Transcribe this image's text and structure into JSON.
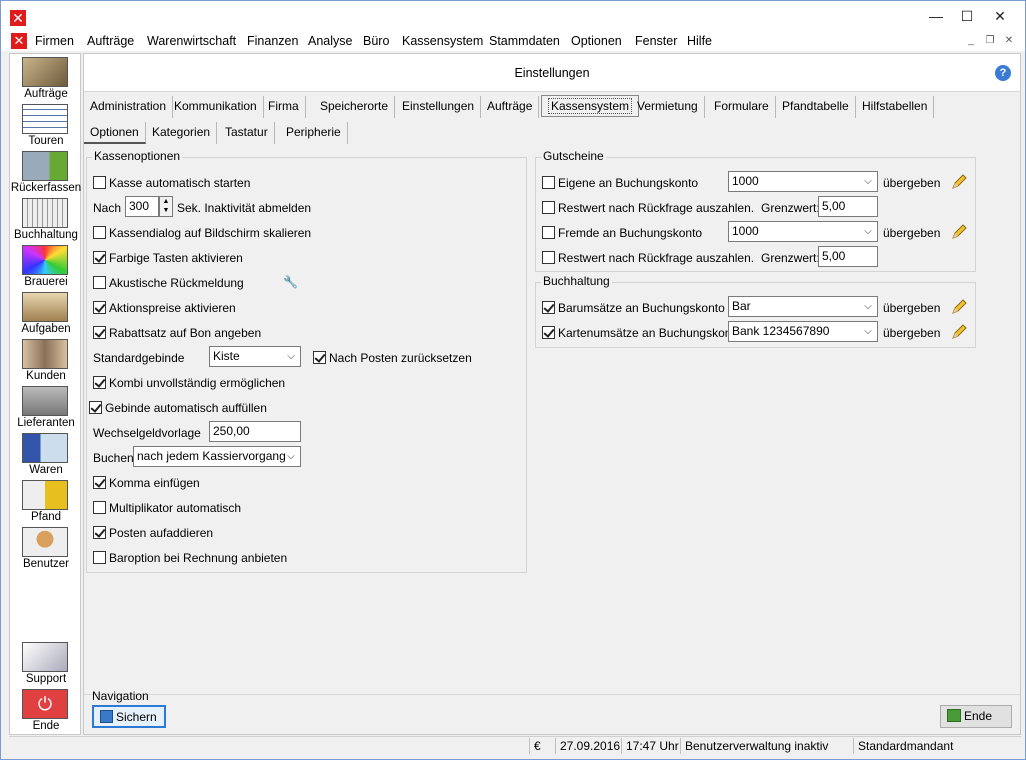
{
  "menubar": {
    "items": [
      "Firmen",
      "Aufträge",
      "Warenwirtschaft",
      "Finanzen",
      "Analyse",
      "Büro",
      "Kassensystem",
      "Stammdaten",
      "Optionen",
      "Fenster",
      "Hilfe"
    ]
  },
  "sidebar": {
    "items": [
      {
        "label": "Aufträge",
        "icon": "headset-person-icon"
      },
      {
        "label": "Touren",
        "icon": "calendar-icon"
      },
      {
        "label": "Rückerfassen",
        "icon": "truck-check-icon"
      },
      {
        "label": "Buchhaltung",
        "icon": "ledger-icon"
      },
      {
        "label": "Brauerei",
        "icon": "color-wheel-icon"
      },
      {
        "label": "Aufgaben",
        "icon": "checklist-icon"
      },
      {
        "label": "Kunden",
        "icon": "handshake-people-icon"
      },
      {
        "label": "Lieferanten",
        "icon": "warehouse-icon"
      },
      {
        "label": "Waren",
        "icon": "bottles-icon"
      },
      {
        "label": "Pfand",
        "icon": "crate-icon"
      },
      {
        "label": "Benutzer",
        "icon": "user-icon"
      }
    ],
    "bottom": [
      {
        "label": "Support",
        "icon": "handshake-icon"
      },
      {
        "label": "Ende",
        "icon": "power-icon"
      }
    ]
  },
  "main": {
    "title": "Einstellungen",
    "tabs": [
      "Administration",
      "Kommunikation",
      "Firma",
      "Speicherorte",
      "Einstellungen",
      "Aufträge",
      "Kassensystem",
      "Vermietung",
      "Formulare",
      "Pfandtabelle",
      "Hilfstabellen"
    ],
    "subtabs": [
      "Optionen",
      "Kategorien",
      "Tastatur",
      "Peripherie"
    ]
  },
  "kassenoptionen": {
    "title": "Kassenoptionen",
    "kasse_auto": "Kasse automatisch starten",
    "nach": "Nach",
    "nach_value": "300",
    "inaktiv": "Sek. Inaktivität abmelden",
    "skalieren": "Kassendialog auf Bildschirm skalieren",
    "farbige": "Farbige Tasten aktivieren",
    "akustisch": "Akustische Rückmeldung",
    "aktionspreise": "Aktionspreise aktivieren",
    "rabattsatz": "Rabattsatz auf Bon angeben",
    "standardgebinde": "Standardgebinde",
    "standardgebinde_value": "Kiste",
    "nach_posten": "Nach Posten zurücksetzen",
    "kombi": "Kombi unvollständig ermöglichen",
    "gebinde_auto": "Gebinde automatisch auffüllen",
    "wechselgeld": "Wechselgeldvorlage",
    "wechselgeld_value": "250,00",
    "buchen": "Buchen",
    "buchen_value": "nach jedem Kassiervorgang",
    "komma": "Komma einfügen",
    "multiplikator": "Multiplikator automatisch",
    "posten": "Posten aufaddieren",
    "baroption": "Baroption bei Rechnung anbieten"
  },
  "gutscheine": {
    "title": "Gutscheine",
    "eigene": "Eigene an Buchungskonto",
    "eigene_value": "1000",
    "restwert1": "Restwert nach Rückfrage auszahlen.",
    "grenzwert_label": "Grenzwert:",
    "grenzwert1": "5,00",
    "fremde": "Fremde an Buchungskonto",
    "fremde_value": "1000",
    "restwert2": "Restwert nach Rückfrage auszahlen.",
    "grenzwert2": "5,00",
    "uebergeben": "übergeben"
  },
  "buchhaltung": {
    "title": "Buchhaltung",
    "barumsaetze": "Barumsätze an Buchungskonto",
    "barumsaetze_value": "Bar",
    "kartenumsaetze": "Kartenumsätze an Buchungskonto",
    "kartenumsaetze_value": "Bank 1234567890",
    "uebergeben": "übergeben"
  },
  "navigation": {
    "label": "Navigation",
    "save": "Sichern",
    "end": "Ende"
  },
  "statusbar": {
    "currency": "€",
    "date": "27.09.2016",
    "time": "17:47 Uhr",
    "user_mgmt": "Benutzerverwaltung inaktiv",
    "client": "Standardmandant"
  }
}
